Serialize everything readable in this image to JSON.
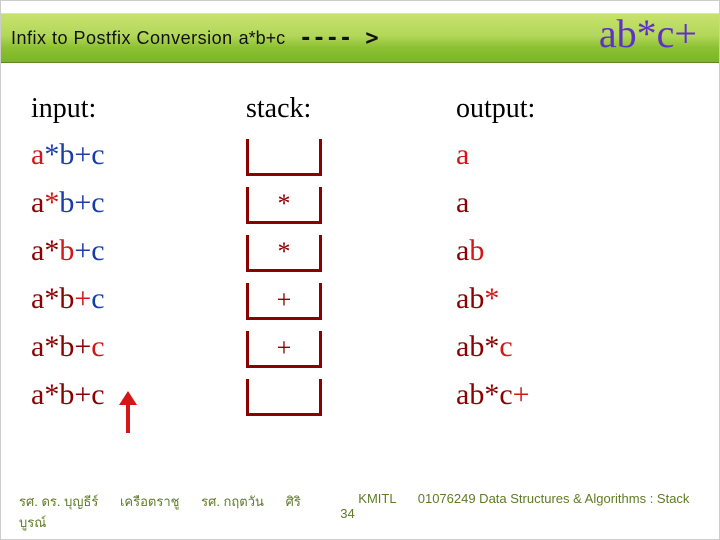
{
  "titlebar": {
    "main": "Infix to Postfix Conversion",
    "expr": "a*b+c",
    "arrow": "---- >",
    "result": "ab*c+"
  },
  "headers": {
    "input": "input:",
    "stack": "stack:",
    "output": "output:"
  },
  "steps": [
    {
      "input_hi": 0,
      "stack": " ",
      "output": "a"
    },
    {
      "input_hi": 1,
      "stack": "*",
      "output": "a"
    },
    {
      "input_hi": 2,
      "stack": "*",
      "output": "ab"
    },
    {
      "input_hi": 3,
      "stack": "+",
      "output": "ab*"
    },
    {
      "input_hi": 4,
      "stack": "+",
      "output": "ab*c"
    },
    {
      "input_hi": 5,
      "stack": " ",
      "output": "ab*c+"
    }
  ],
  "expr_chars": [
    "a",
    "*",
    "b",
    "+",
    "c"
  ],
  "footer": {
    "name1": "รศ. ดร. บุญธีร์",
    "name2": "เครือตราชู",
    "name3": "รศ. กฤตวัน",
    "name4": "ศิริบูรณ์",
    "org": "KMITL",
    "course": "01076249 Data Structures & Algorithms : Stack 34"
  }
}
